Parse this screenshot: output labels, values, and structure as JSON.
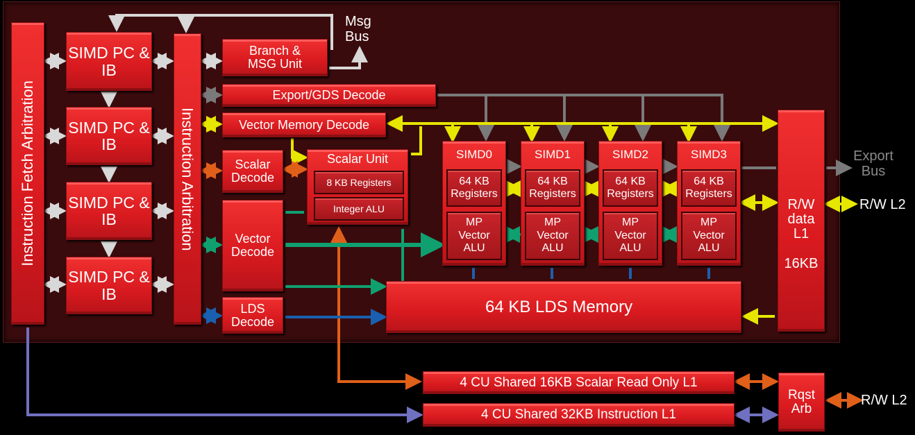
{
  "colors": {
    "panel": "#3a0b0d",
    "block": "#d81a1f",
    "white_bus": "#d8d8d8",
    "gray_bus": "#7a7a7a",
    "yellow_bus": "#e6e600",
    "orange_bus": "#e0601a",
    "green_bus": "#10a070",
    "blue_bus": "#1a60b0",
    "purple_bus": "#7070c0"
  },
  "blocks": {
    "instruction_fetch_arbitration": "Instruction Fetch Arbitration",
    "instruction_arbitration": "Instruction Arbitration",
    "simd_pc_ib": [
      "SIMD PC & IB",
      "SIMD PC & IB",
      "SIMD PC & IB",
      "SIMD PC & IB"
    ],
    "branch_msg_unit": "Branch & MSG Unit",
    "export_gds_decode": "Export/GDS Decode",
    "vector_memory_decode": "Vector Memory Decode",
    "scalar_decode": "Scalar Decode",
    "vector_decode": "Vector Decode",
    "lds_decode": "LDS Decode",
    "scalar_unit": {
      "title": "Scalar Unit",
      "registers": "8 KB Registers",
      "alu": "Integer ALU"
    },
    "simds": [
      {
        "title": "SIMD0",
        "registers": "64 KB Registers",
        "alu": "MP Vector ALU"
      },
      {
        "title": "SIMD1",
        "registers": "64 KB Registers",
        "alu": "MP Vector ALU"
      },
      {
        "title": "SIMD2",
        "registers": "64 KB Registers",
        "alu": "MP Vector ALU"
      },
      {
        "title": "SIMD3",
        "registers": "64 KB Registers",
        "alu": "MP Vector ALU"
      }
    ],
    "lds_memory": "64 KB LDS Memory",
    "rw_data_l1": "R/W data L1",
    "rw_data_l1_size": "16KB",
    "scalar_read_only_l1": "4 CU Shared 16KB Scalar Read Only L1",
    "instruction_l1": "4 CU Shared 32KB Instruction L1",
    "rqst_arb": "Rqst Arb"
  },
  "labels": {
    "msg_bus": "Msg Bus",
    "export_bus": "Export Bus",
    "rw_l2_top": "R/W L2",
    "rw_l2_bottom": "R/W L2"
  }
}
